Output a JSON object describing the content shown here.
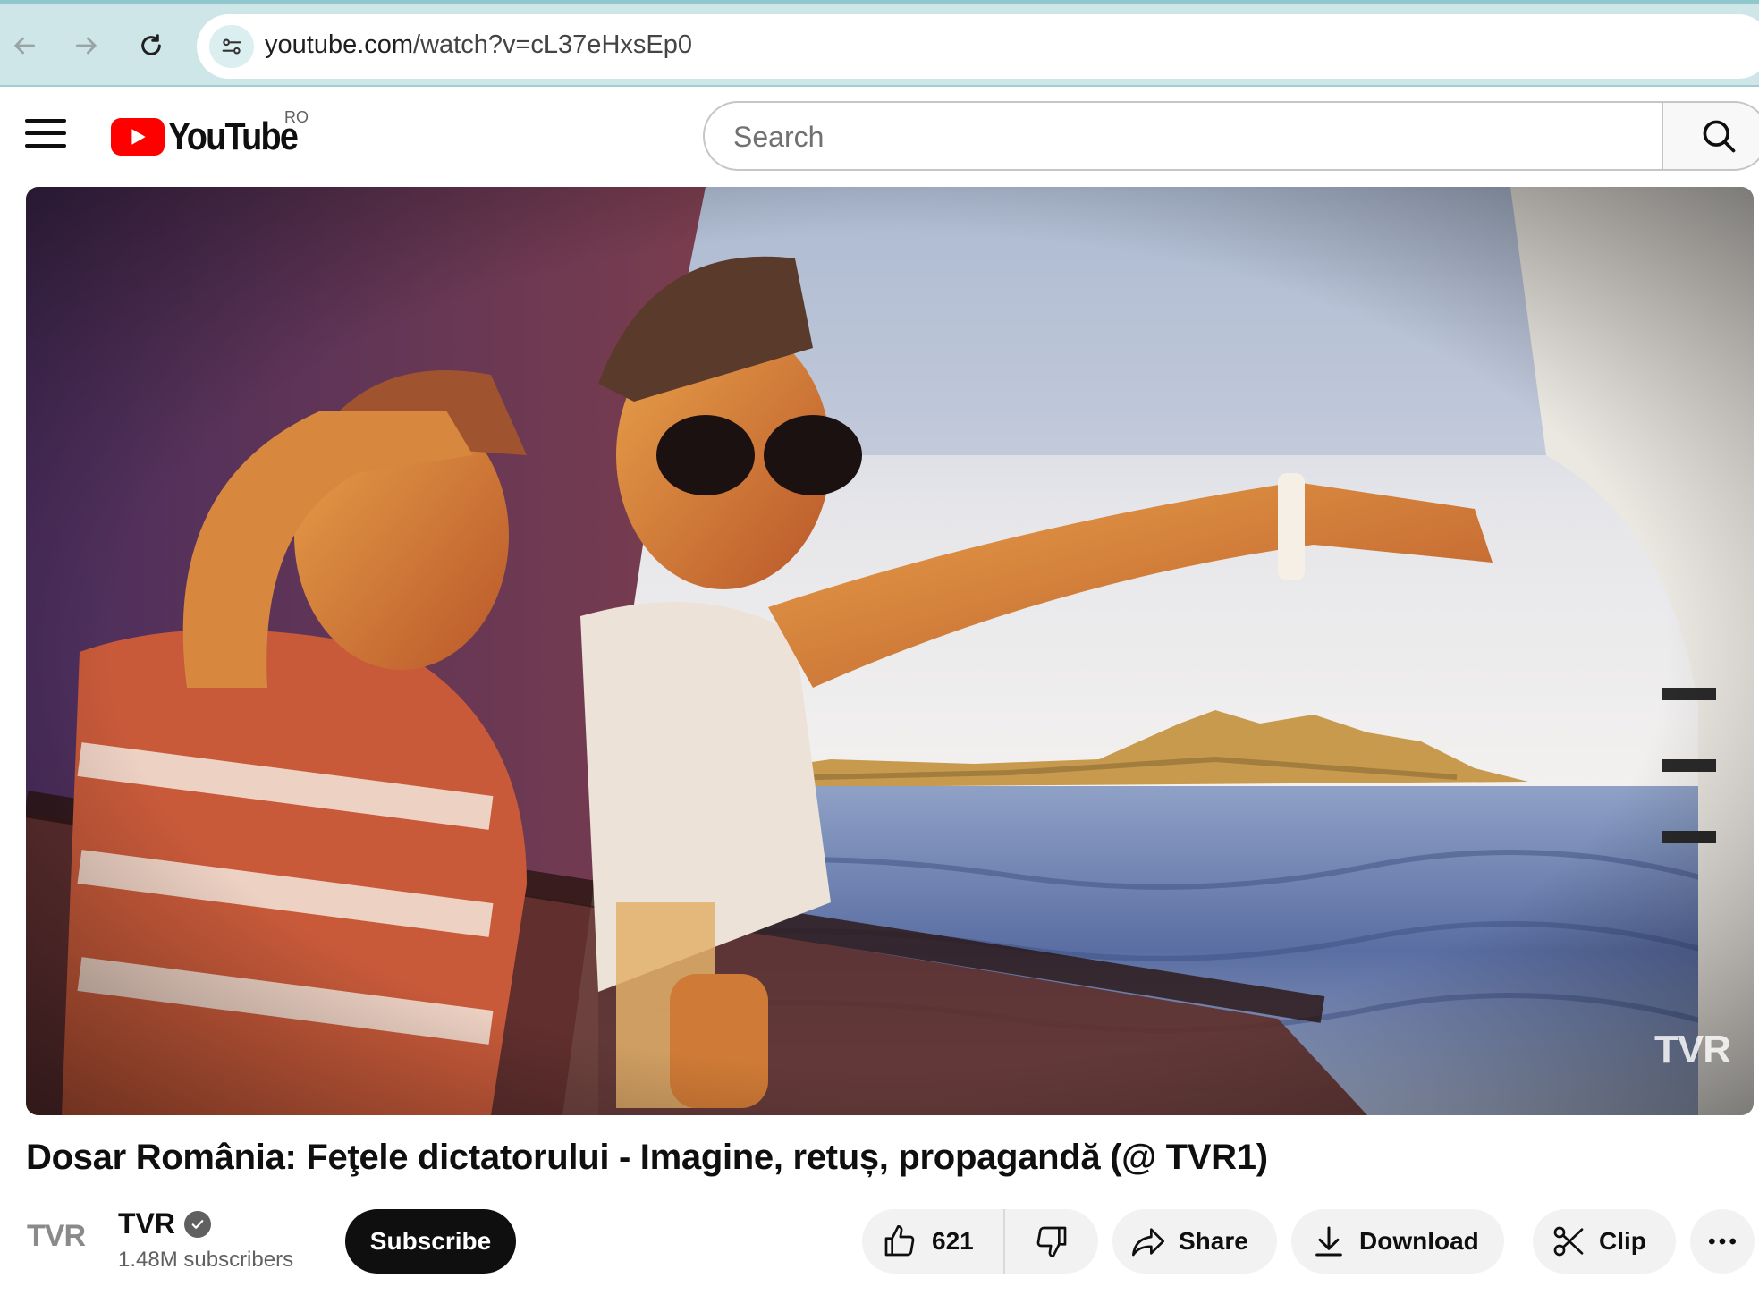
{
  "browser": {
    "url_host": "youtube.com",
    "url_path": "/watch?v=cL37eHxsEp0"
  },
  "header": {
    "logo_text": "YouTube",
    "country_code": "RO",
    "search_placeholder": "Search"
  },
  "video": {
    "watermark": "TVR",
    "title": "Dosar România: Feţele dictatorului - Imagine, retuș, propagandă (@ TVR1)"
  },
  "channel": {
    "avatar_text": "TVR",
    "name": "TVR",
    "subscribers": "1.48M subscribers",
    "subscribe_label": "Subscribe"
  },
  "actions": {
    "like_count": "621",
    "share_label": "Share",
    "download_label": "Download",
    "clip_label": "Clip"
  },
  "icons": {
    "back": "arrow-left-icon",
    "forward": "arrow-right-icon",
    "reload": "reload-icon",
    "site_info": "tune-icon",
    "menu": "hamburger-icon",
    "search": "search-icon",
    "verified": "checkmark-badge-icon",
    "like": "thumb-up-icon",
    "dislike": "thumb-down-icon",
    "share": "share-arrow-icon",
    "download": "download-icon",
    "clip": "scissors-icon",
    "more": "more-horizontal-icon"
  },
  "colors": {
    "browser_bar": "#cfe6e8",
    "youtube_red": "#ff0000",
    "subscribe_bg": "#0f0f0f",
    "pill_bg": "#f2f2f2"
  }
}
